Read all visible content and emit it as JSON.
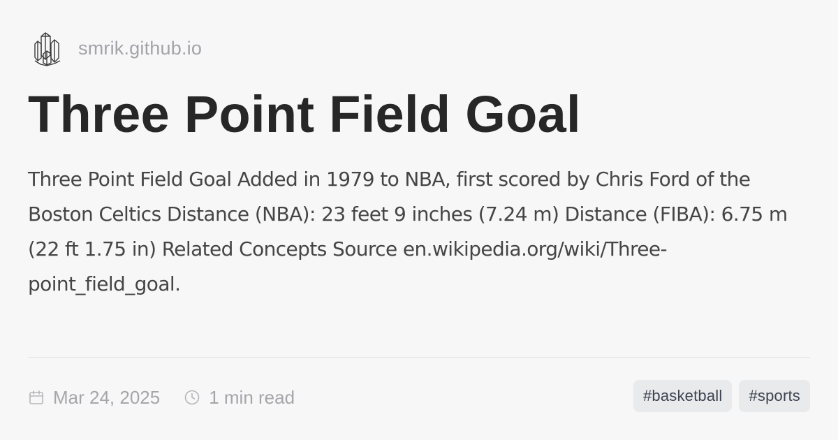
{
  "site": {
    "name": "smrik.github.io",
    "logo_icon": "crystal-cluster-icon"
  },
  "post": {
    "title": "Three Point Field Goal",
    "description": "Three Point Field Goal Added in 1979 to NBA, first scored by Chris Ford of the Boston Celtics Distance (NBA): 23 feet 9 inches (7.24 m) Distance (FIBA): 6.75 m (22 ft 1.75 in) Related Concepts Source en.wikipedia.org/wiki/Three-point_field_goal."
  },
  "meta": {
    "date": "Mar 24, 2025",
    "date_icon": "calendar-icon",
    "read_time": "1 min read",
    "read_time_icon": "clock-icon"
  },
  "tags": [
    {
      "label": "#basketball"
    },
    {
      "label": "#sports"
    }
  ],
  "colors": {
    "background": "#f7f7f8",
    "title": "#272727",
    "muted": "#a6a6aa",
    "tag_bg": "#e9eaec",
    "tag_text": "#3d4350"
  }
}
